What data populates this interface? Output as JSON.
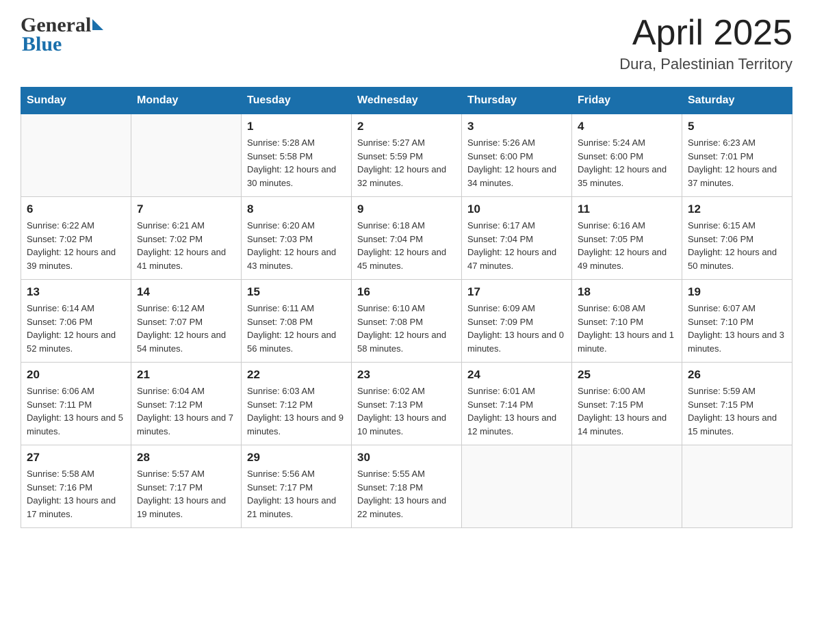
{
  "header": {
    "logo_general": "General",
    "logo_blue": "Blue",
    "month_year": "April 2025",
    "location": "Dura, Palestinian Territory"
  },
  "days_of_week": [
    "Sunday",
    "Monday",
    "Tuesday",
    "Wednesday",
    "Thursday",
    "Friday",
    "Saturday"
  ],
  "weeks": [
    [
      {
        "day": "",
        "sunrise": "",
        "sunset": "",
        "daylight": ""
      },
      {
        "day": "",
        "sunrise": "",
        "sunset": "",
        "daylight": ""
      },
      {
        "day": "1",
        "sunrise": "Sunrise: 5:28 AM",
        "sunset": "Sunset: 5:58 PM",
        "daylight": "Daylight: 12 hours and 30 minutes."
      },
      {
        "day": "2",
        "sunrise": "Sunrise: 5:27 AM",
        "sunset": "Sunset: 5:59 PM",
        "daylight": "Daylight: 12 hours and 32 minutes."
      },
      {
        "day": "3",
        "sunrise": "Sunrise: 5:26 AM",
        "sunset": "Sunset: 6:00 PM",
        "daylight": "Daylight: 12 hours and 34 minutes."
      },
      {
        "day": "4",
        "sunrise": "Sunrise: 5:24 AM",
        "sunset": "Sunset: 6:00 PM",
        "daylight": "Daylight: 12 hours and 35 minutes."
      },
      {
        "day": "5",
        "sunrise": "Sunrise: 6:23 AM",
        "sunset": "Sunset: 7:01 PM",
        "daylight": "Daylight: 12 hours and 37 minutes."
      }
    ],
    [
      {
        "day": "6",
        "sunrise": "Sunrise: 6:22 AM",
        "sunset": "Sunset: 7:02 PM",
        "daylight": "Daylight: 12 hours and 39 minutes."
      },
      {
        "day": "7",
        "sunrise": "Sunrise: 6:21 AM",
        "sunset": "Sunset: 7:02 PM",
        "daylight": "Daylight: 12 hours and 41 minutes."
      },
      {
        "day": "8",
        "sunrise": "Sunrise: 6:20 AM",
        "sunset": "Sunset: 7:03 PM",
        "daylight": "Daylight: 12 hours and 43 minutes."
      },
      {
        "day": "9",
        "sunrise": "Sunrise: 6:18 AM",
        "sunset": "Sunset: 7:04 PM",
        "daylight": "Daylight: 12 hours and 45 minutes."
      },
      {
        "day": "10",
        "sunrise": "Sunrise: 6:17 AM",
        "sunset": "Sunset: 7:04 PM",
        "daylight": "Daylight: 12 hours and 47 minutes."
      },
      {
        "day": "11",
        "sunrise": "Sunrise: 6:16 AM",
        "sunset": "Sunset: 7:05 PM",
        "daylight": "Daylight: 12 hours and 49 minutes."
      },
      {
        "day": "12",
        "sunrise": "Sunrise: 6:15 AM",
        "sunset": "Sunset: 7:06 PM",
        "daylight": "Daylight: 12 hours and 50 minutes."
      }
    ],
    [
      {
        "day": "13",
        "sunrise": "Sunrise: 6:14 AM",
        "sunset": "Sunset: 7:06 PM",
        "daylight": "Daylight: 12 hours and 52 minutes."
      },
      {
        "day": "14",
        "sunrise": "Sunrise: 6:12 AM",
        "sunset": "Sunset: 7:07 PM",
        "daylight": "Daylight: 12 hours and 54 minutes."
      },
      {
        "day": "15",
        "sunrise": "Sunrise: 6:11 AM",
        "sunset": "Sunset: 7:08 PM",
        "daylight": "Daylight: 12 hours and 56 minutes."
      },
      {
        "day": "16",
        "sunrise": "Sunrise: 6:10 AM",
        "sunset": "Sunset: 7:08 PM",
        "daylight": "Daylight: 12 hours and 58 minutes."
      },
      {
        "day": "17",
        "sunrise": "Sunrise: 6:09 AM",
        "sunset": "Sunset: 7:09 PM",
        "daylight": "Daylight: 13 hours and 0 minutes."
      },
      {
        "day": "18",
        "sunrise": "Sunrise: 6:08 AM",
        "sunset": "Sunset: 7:10 PM",
        "daylight": "Daylight: 13 hours and 1 minute."
      },
      {
        "day": "19",
        "sunrise": "Sunrise: 6:07 AM",
        "sunset": "Sunset: 7:10 PM",
        "daylight": "Daylight: 13 hours and 3 minutes."
      }
    ],
    [
      {
        "day": "20",
        "sunrise": "Sunrise: 6:06 AM",
        "sunset": "Sunset: 7:11 PM",
        "daylight": "Daylight: 13 hours and 5 minutes."
      },
      {
        "day": "21",
        "sunrise": "Sunrise: 6:04 AM",
        "sunset": "Sunset: 7:12 PM",
        "daylight": "Daylight: 13 hours and 7 minutes."
      },
      {
        "day": "22",
        "sunrise": "Sunrise: 6:03 AM",
        "sunset": "Sunset: 7:12 PM",
        "daylight": "Daylight: 13 hours and 9 minutes."
      },
      {
        "day": "23",
        "sunrise": "Sunrise: 6:02 AM",
        "sunset": "Sunset: 7:13 PM",
        "daylight": "Daylight: 13 hours and 10 minutes."
      },
      {
        "day": "24",
        "sunrise": "Sunrise: 6:01 AM",
        "sunset": "Sunset: 7:14 PM",
        "daylight": "Daylight: 13 hours and 12 minutes."
      },
      {
        "day": "25",
        "sunrise": "Sunrise: 6:00 AM",
        "sunset": "Sunset: 7:15 PM",
        "daylight": "Daylight: 13 hours and 14 minutes."
      },
      {
        "day": "26",
        "sunrise": "Sunrise: 5:59 AM",
        "sunset": "Sunset: 7:15 PM",
        "daylight": "Daylight: 13 hours and 15 minutes."
      }
    ],
    [
      {
        "day": "27",
        "sunrise": "Sunrise: 5:58 AM",
        "sunset": "Sunset: 7:16 PM",
        "daylight": "Daylight: 13 hours and 17 minutes."
      },
      {
        "day": "28",
        "sunrise": "Sunrise: 5:57 AM",
        "sunset": "Sunset: 7:17 PM",
        "daylight": "Daylight: 13 hours and 19 minutes."
      },
      {
        "day": "29",
        "sunrise": "Sunrise: 5:56 AM",
        "sunset": "Sunset: 7:17 PM",
        "daylight": "Daylight: 13 hours and 21 minutes."
      },
      {
        "day": "30",
        "sunrise": "Sunrise: 5:55 AM",
        "sunset": "Sunset: 7:18 PM",
        "daylight": "Daylight: 13 hours and 22 minutes."
      },
      {
        "day": "",
        "sunrise": "",
        "sunset": "",
        "daylight": ""
      },
      {
        "day": "",
        "sunrise": "",
        "sunset": "",
        "daylight": ""
      },
      {
        "day": "",
        "sunrise": "",
        "sunset": "",
        "daylight": ""
      }
    ]
  ]
}
